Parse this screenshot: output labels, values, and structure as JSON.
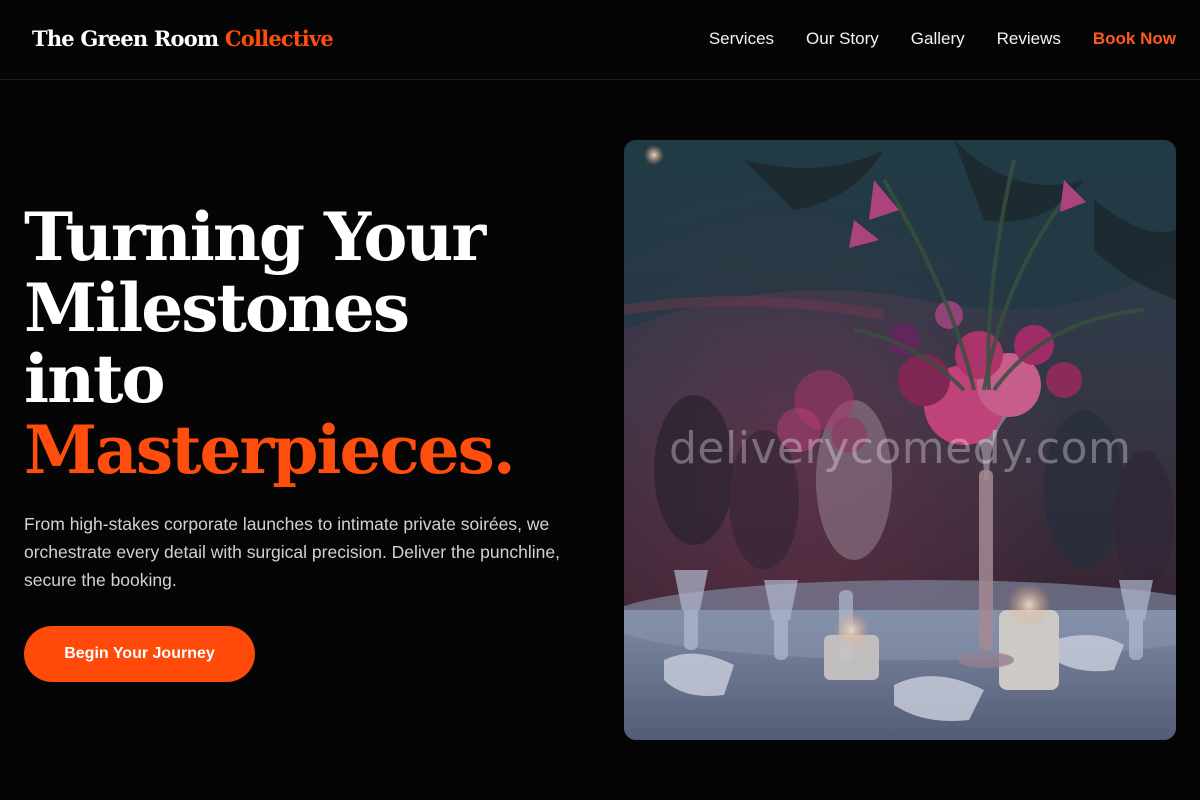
{
  "brand": {
    "name_main": "The Green Room",
    "name_accent": "Collective"
  },
  "nav": {
    "items": [
      "Services",
      "Our Story",
      "Gallery",
      "Reviews"
    ],
    "cta": "Book Now"
  },
  "hero": {
    "title_lines": [
      "Turning Your",
      "Milestones",
      "into"
    ],
    "title_accent": "Masterpieces.",
    "description": "From high-stakes corporate launches to intimate private soirées, we orchestrate every detail with surgical precision. Deliver the punchline, secure the booking.",
    "button_label": "Begin Your Journey"
  },
  "image": {
    "subject": "event banquet table with floral centerpiece",
    "watermark": "deliverycomedy.com"
  },
  "colors": {
    "background": "#050505",
    "accent": "#ff4d0d",
    "text": "#ffffff",
    "muted_text": "#d2d2d2"
  }
}
